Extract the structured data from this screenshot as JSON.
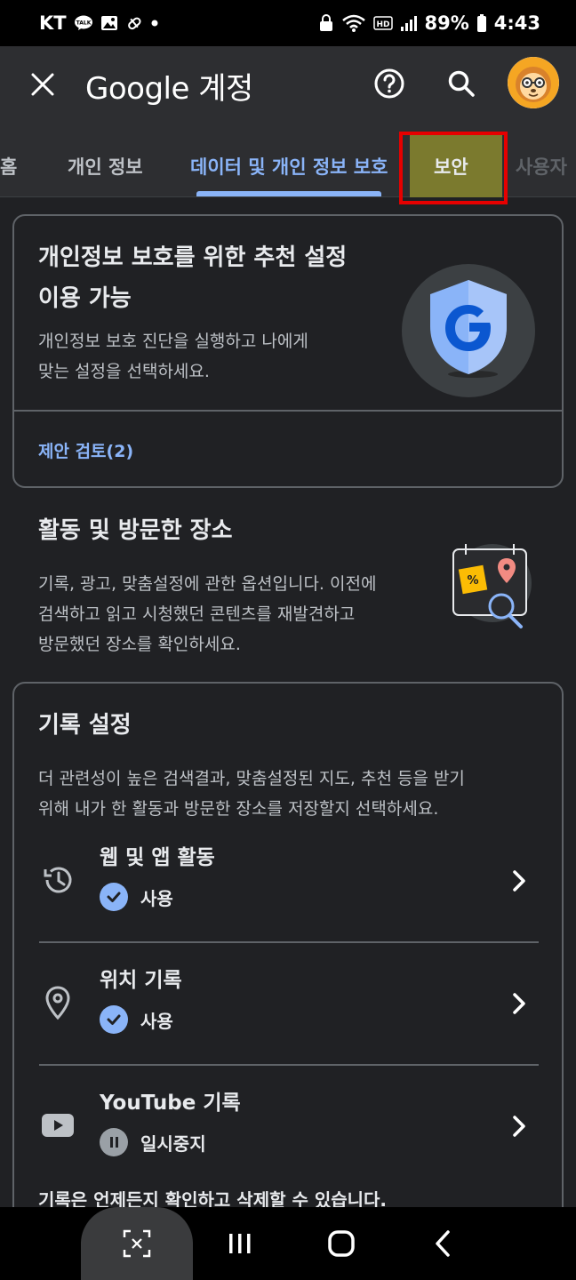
{
  "status_bar": {
    "carrier": "KT",
    "battery": "89%",
    "time": "4:43"
  },
  "app_bar": {
    "title": "Google 계정"
  },
  "tabs": [
    {
      "label": "홈"
    },
    {
      "label": "개인 정보"
    },
    {
      "label": "데이터 및 개인 정보 보호",
      "active": true
    },
    {
      "label": "보안",
      "highlighted": true
    },
    {
      "label": "사용자"
    }
  ],
  "privacy_card": {
    "title_line1": "개인정보 보호를 위한 추천 설정",
    "title_line2": "이용 가능",
    "desc_line1": "개인정보 보호 진단을 실행하고 나에게",
    "desc_line2": "맞는 설정을 선택하세요.",
    "link": "제안 검토(2)"
  },
  "activity_section": {
    "title": "활동 및 방문한 장소",
    "desc_line1": "기록, 광고, 맞춤설정에 관한 옵션입니다. 이전에",
    "desc_line2": "검색하고 읽고 시청했던 콘텐츠를 재발견하고",
    "desc_line3": "방문했던 장소를 확인하세요."
  },
  "history_card": {
    "title": "기록 설정",
    "desc_line1": "더 관련성이 높은 검색결과, 맞춤설정된 지도, 추천 등을 받기",
    "desc_line2": "위해 내가 한 활동과 방문한 장소를 저장할지 선택하세요.",
    "rows": [
      {
        "icon": "history-icon",
        "title": "웹 및 앱 활동",
        "status": "사용",
        "state": "on"
      },
      {
        "icon": "location-pin-icon",
        "title": "위치 기록",
        "status": "사용",
        "state": "on"
      },
      {
        "icon": "youtube-icon",
        "title": "YouTube 기록",
        "status": "일시중지",
        "state": "paused"
      }
    ],
    "footer": "기록은 언제든지 확인하고 삭제할 수 있습니다."
  },
  "colors": {
    "background": "#202124",
    "accent": "#8ab4f8",
    "highlight_border": "#e60000",
    "highlight_fill": "#7b7a2e"
  }
}
